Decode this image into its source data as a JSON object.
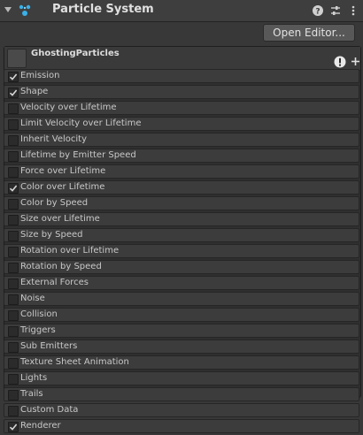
{
  "header": {
    "title": "Particle System"
  },
  "open_editor_label": "Open Editor...",
  "effect": {
    "name": "GhostingParticles"
  },
  "modules": [
    {
      "label": "Emission",
      "checked": true
    },
    {
      "label": "Shape",
      "checked": true
    },
    {
      "label": "Velocity over Lifetime",
      "checked": false
    },
    {
      "label": "Limit Velocity over Lifetime",
      "checked": false
    },
    {
      "label": "Inherit Velocity",
      "checked": false
    },
    {
      "label": "Lifetime by Emitter Speed",
      "checked": false
    },
    {
      "label": "Force over Lifetime",
      "checked": false
    },
    {
      "label": "Color over Lifetime",
      "checked": true
    },
    {
      "label": "Color by Speed",
      "checked": false
    },
    {
      "label": "Size over Lifetime",
      "checked": false
    },
    {
      "label": "Size by Speed",
      "checked": false
    },
    {
      "label": "Rotation over Lifetime",
      "checked": false
    },
    {
      "label": "Rotation by Speed",
      "checked": false
    },
    {
      "label": "External Forces",
      "checked": false
    },
    {
      "label": "Noise",
      "checked": false
    },
    {
      "label": "Collision",
      "checked": false
    },
    {
      "label": "Triggers",
      "checked": false
    },
    {
      "label": "Sub Emitters",
      "checked": false
    },
    {
      "label": "Texture Sheet Animation",
      "checked": false
    },
    {
      "label": "Lights",
      "checked": false
    },
    {
      "label": "Trails",
      "checked": false
    },
    {
      "label": "Custom Data",
      "checked": false
    },
    {
      "label": "Renderer",
      "checked": true
    }
  ],
  "icons": {
    "foldout": "foldout-arrow-icon",
    "component": "particle-system-icon",
    "help": "help-icon",
    "preset": "preset-icon",
    "menu": "kebab-menu-icon",
    "warning": "warning-icon",
    "add": "plus-icon"
  },
  "colors": {
    "component_icon": "#3ab0e8",
    "checkmark": "#d8d8d8"
  }
}
